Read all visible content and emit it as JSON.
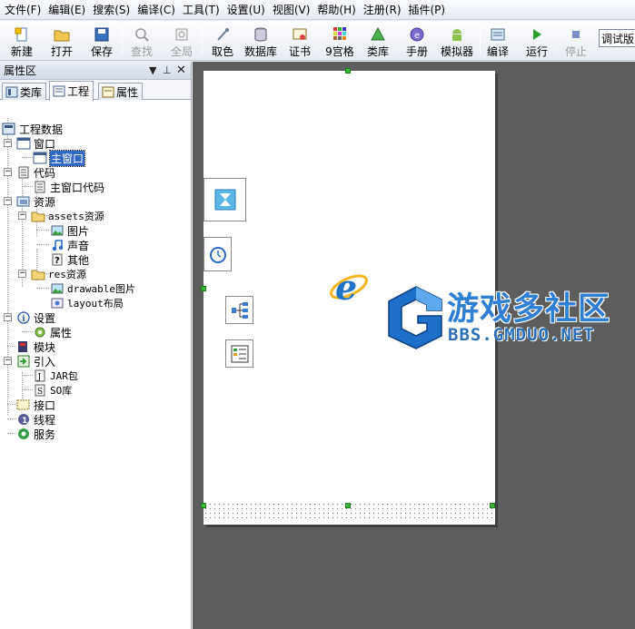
{
  "menu": [
    "文件(F)",
    "编辑(E)",
    "搜索(S)",
    "编译(C)",
    "工具(T)",
    "设置(U)",
    "视图(V)",
    "帮助(H)",
    "注册(R)",
    "插件(P)"
  ],
  "toolbar": {
    "new": "新建",
    "open": "打开",
    "save": "保存",
    "find": "查找",
    "find_all": "全局",
    "color_pick": "取色",
    "database": "数据库",
    "certificate": "证书",
    "nine_grid": "9宫格",
    "library": "类库",
    "manual": "手册",
    "emulator": "模拟器",
    "compile": "编译",
    "run": "运行",
    "stop": "停止",
    "mode": "调试版"
  },
  "panel": {
    "title": "属性区",
    "tabs": [
      "类库",
      "工程",
      "属性"
    ]
  },
  "tree": {
    "root": "工程数据",
    "window": "窗口",
    "main_window": "主窗口",
    "code": "代码",
    "main_window_code": "主窗口代码",
    "resources": "资源",
    "assets": "assets资源",
    "images": "图片",
    "sounds": "声音",
    "others": "其他",
    "res": "res资源",
    "drawable": "drawable图片",
    "layout": "layout布局",
    "settings": "设置",
    "properties": "属性",
    "modules": "模块",
    "imports": "引入",
    "jar": "JAR包",
    "so": "SO库",
    "interfaces": "接口",
    "threads": "线程",
    "services": "服务"
  },
  "watermark": {
    "title": "游戏多社区",
    "url": "BBS.GMDUO.NET"
  },
  "colors": {
    "workspace_bg": "#5d5d5d",
    "selection": "#3169c6",
    "handle": "#38b838",
    "watermark_blue": "#2f7fd4"
  }
}
